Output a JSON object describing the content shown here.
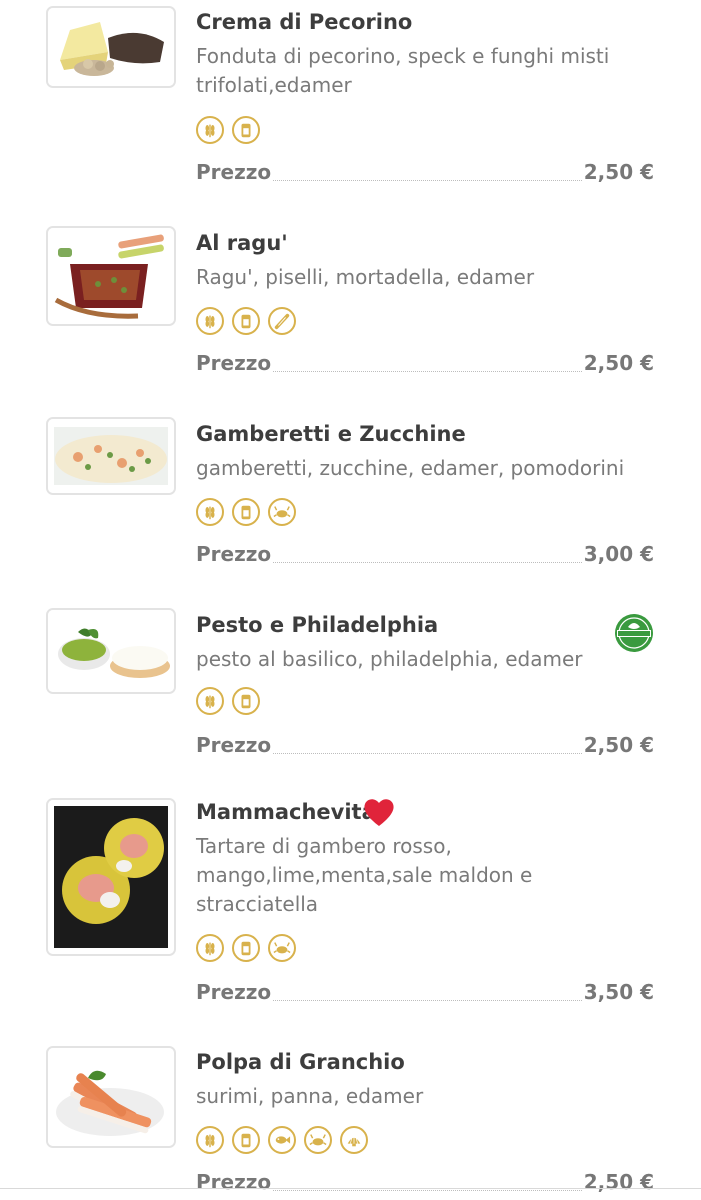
{
  "menu": {
    "items": [
      {
        "name": "Crema di Pecorino",
        "description": "Fonduta di pecorino, speck e funghi misti trifolati,edamer",
        "allergens": [
          "wheat-icon",
          "milk-jar-icon"
        ],
        "price_label": "Prezzo",
        "price": "2,50 €"
      },
      {
        "name": "Al ragu'",
        "description": "Ragu', piselli, mortadella, edamer",
        "allergens": [
          "wheat-icon",
          "milk-jar-icon",
          "celery-icon"
        ],
        "price_label": "Prezzo",
        "price": "2,50 €"
      },
      {
        "name": "Gamberetti e Zucchine",
        "description": "gamberetti, zucchine, edamer, pomodorini",
        "allergens": [
          "wheat-icon",
          "milk-jar-icon",
          "crab-icon"
        ],
        "price_label": "Prezzo",
        "price": "3,00 €"
      },
      {
        "name": "Pesto e Philadelphia",
        "description": "pesto al basilico, philadelphia, edamer",
        "allergens": [
          "wheat-icon",
          "milk-jar-icon"
        ],
        "badge": "VEGETARIAN",
        "price_label": "Prezzo",
        "price": "2,50 €"
      },
      {
        "name": "Mammachevita",
        "name_emoji": "heart-icon",
        "description": "Tartare di gambero rosso, mango,lime,menta,sale maldon e stracciatella",
        "allergens": [
          "wheat-icon",
          "milk-jar-icon",
          "crab-icon"
        ],
        "price_label": "Prezzo",
        "price": "3,50 €"
      },
      {
        "name": "Polpa di Granchio",
        "description": "surimi, panna, edamer",
        "allergens": [
          "wheat-icon",
          "milk-jar-icon",
          "fish-icon",
          "crab-icon",
          "shell-icon"
        ],
        "price_label": "Prezzo",
        "price": "2,50 €"
      }
    ]
  },
  "colors": {
    "allergen_gold": "#d8b24c",
    "veg_green": "#3a9a3f",
    "heart_red": "#e0243a"
  }
}
